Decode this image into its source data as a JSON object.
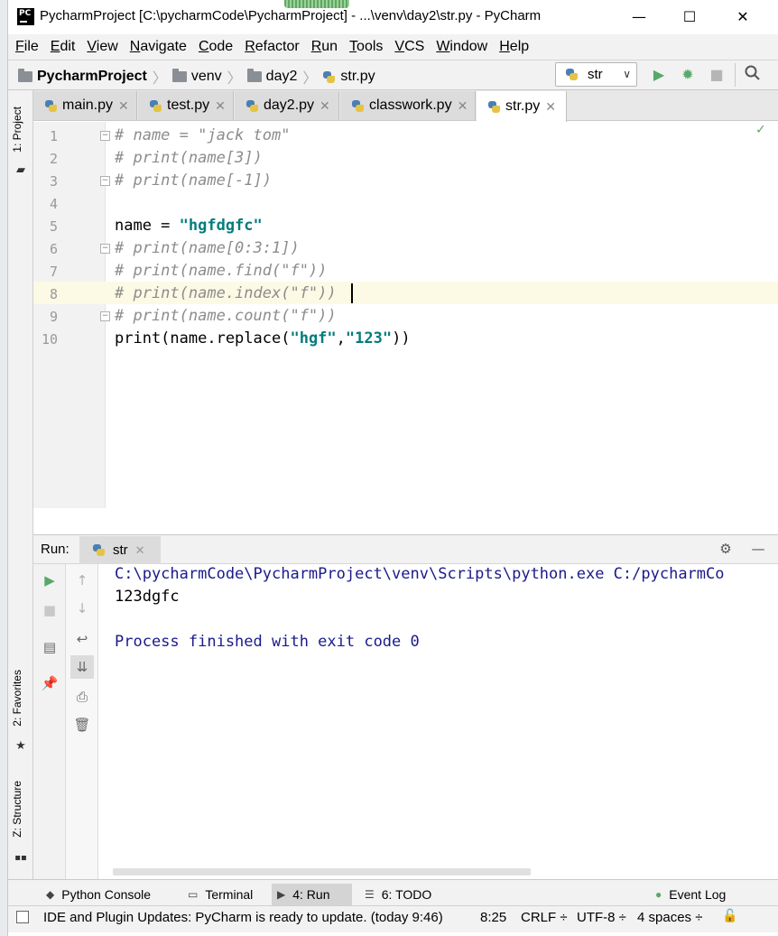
{
  "window": {
    "title": "PycharmProject [C:\\pycharmCode\\PycharmProject] - ...\\venv\\day2\\str.py - PyCharm",
    "logo_text": "PC",
    "minimize": "—",
    "maximize": "☐",
    "close": "✕"
  },
  "menu": [
    "File",
    "Edit",
    "View",
    "Navigate",
    "Code",
    "Refactor",
    "Run",
    "Tools",
    "VCS",
    "Window",
    "Help"
  ],
  "breadcrumb": {
    "project": "PycharmProject",
    "folder1": "venv",
    "folder2": "day2",
    "file": "str.py"
  },
  "run_config": {
    "selected": "str"
  },
  "left_tabs": {
    "project": "1: Project",
    "favorites": "2: Favorites",
    "structure": "Z: Structure"
  },
  "editor_tabs": [
    {
      "label": "main.py",
      "active": false
    },
    {
      "label": "test.py",
      "active": false
    },
    {
      "label": "day2.py",
      "active": false
    },
    {
      "label": "classwork.py",
      "active": false
    },
    {
      "label": "str.py",
      "active": true
    }
  ],
  "code_lines": [
    {
      "no": "1",
      "text": "# name = \"jack tom\""
    },
    {
      "no": "2",
      "text": "# print(name[3])"
    },
    {
      "no": "3",
      "text": "# print(name[-1])"
    },
    {
      "no": "4",
      "text": ""
    },
    {
      "no": "5",
      "pre": "name = ",
      "str": "\"hgfdgfc\""
    },
    {
      "no": "6",
      "text": "# print(name[0:3:1])"
    },
    {
      "no": "7",
      "text": "# print(name.find(\"f\"))"
    },
    {
      "no": "8",
      "text": "# print(name.index(\"f\"))"
    },
    {
      "no": "9",
      "text": "# print(name.count(\"f\"))"
    },
    {
      "no": "10",
      "pre": "print(name.replace(",
      "str_a": "\"hgf\"",
      "mid": ",",
      "str_b": "\"123\"",
      "post": "))"
    }
  ],
  "run_panel": {
    "label": "Run:",
    "tab": "str",
    "output": [
      "C:\\pycharmCode\\PycharmProject\\venv\\Scripts\\python.exe C:/pycharmCo",
      "123dgfc",
      "",
      "Process finished with exit code 0"
    ]
  },
  "bottom_tabs": [
    {
      "label": "Python Console",
      "active": false
    },
    {
      "label": "Terminal",
      "active": false
    },
    {
      "label": "4: Run",
      "active": true
    },
    {
      "label": "6: TODO",
      "active": false
    }
  ],
  "event_log": "Event Log",
  "status": {
    "message": "IDE and Plugin Updates: PyCharm is ready to update. (today 9:46)",
    "position": "8:25",
    "line_sep": "CRLF ÷",
    "encoding": "UTF-8 ÷",
    "indent": "4 spaces ÷"
  },
  "colors": {
    "comment": "#8c8c8c",
    "string": "#067d17",
    "console_stdout": "#000000",
    "console_path": "#1a1a8c",
    "run_green": "#59a869"
  }
}
